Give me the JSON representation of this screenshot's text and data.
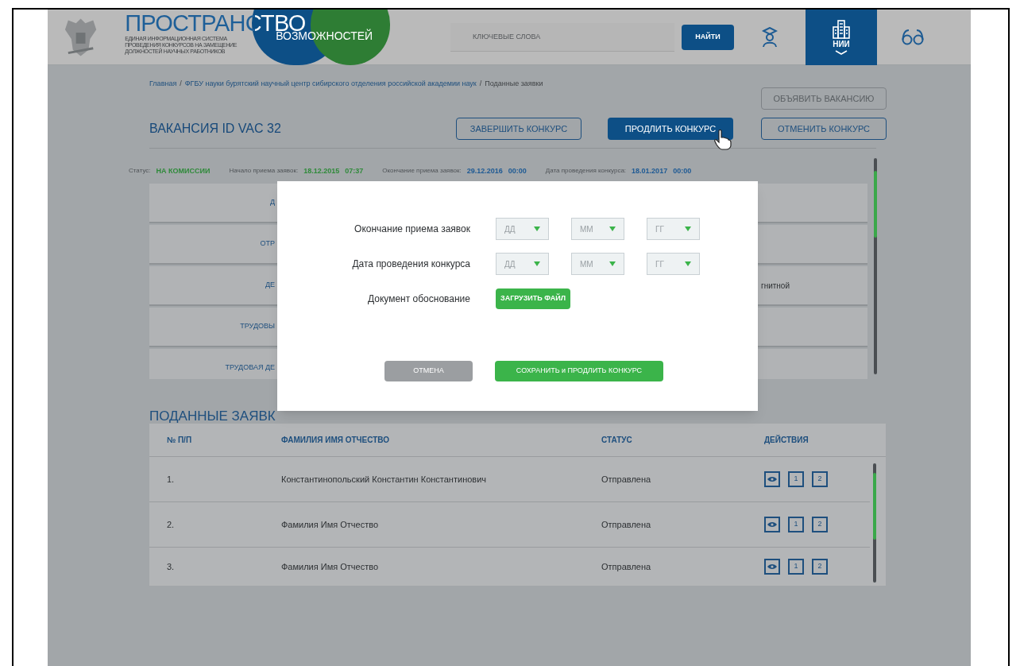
{
  "header": {
    "logo": {
      "title": "ПРОСТРАНСТВО",
      "subtitle": "ВОЗМОЖНОСТЕЙ",
      "tagline": [
        "ЕДИНАЯ ИНФОРМАЦИОННАЯ СИСТЕМА",
        "ПРОВЕДЕНИЯ КОНКУРСОВ НА ЗАМЕЩЕНИЕ",
        "ДОЛЖНОСТЕЙ НАУЧНЫХ РАБОТНИКОВ"
      ]
    },
    "search": {
      "placeholder": "КЛЮЧЕВЫЕ СЛОВА",
      "button": "НАЙТИ"
    },
    "nav": [
      {
        "kind": "person",
        "selected": false
      },
      {
        "kind": "institute",
        "label": "НИИ",
        "selected": true
      },
      {
        "kind": "glasses",
        "selected": false
      }
    ]
  },
  "breadcrumb_separator": "/",
  "breadcrumbs": [
    {
      "label": "Главная",
      "current": false
    },
    {
      "label": "ФГБУ науки бурятский научный центр сибирского отделения российской академии наук",
      "current": false
    },
    {
      "label": "Поданные заявки",
      "current": true
    }
  ],
  "announce_button": "ОБЪЯВИТЬ ВАКАНСИЮ",
  "vacancy": {
    "title": "ВАКАНСИЯ ID VAC 32",
    "actions": [
      {
        "label": "ЗАВЕРШИТЬ КОНКУРС",
        "primary": false
      },
      {
        "label": "ПРОДЛИТЬ КОНКУРС",
        "primary": true
      },
      {
        "label": "ОТМЕНИТЬ КОНКУРС",
        "primary": false
      }
    ]
  },
  "status_line": [
    {
      "label": "Статус:",
      "values": [
        "НА КОМИССИИ"
      ],
      "color": "#2f8a3a"
    },
    {
      "label": "Начало приема заявок:",
      "values": [
        "18.12.2015",
        "07:37"
      ],
      "color": "#2f8a3a"
    },
    {
      "label": "Окончание приема заявок:",
      "values": [
        "29.12.2016",
        "00:00"
      ],
      "color": "#1e5a94"
    },
    {
      "label": "Дата проведения конкурса:",
      "values": [
        "18.01.2017",
        "00:00"
      ],
      "color": "#1e5a94"
    }
  ],
  "detail_rows": [
    {
      "label": "Д"
    },
    {
      "label": "ОТР"
    },
    {
      "label": "ДЕ",
      "value": "гнитной"
    },
    {
      "label": "ТРУДОВЫ"
    },
    {
      "label": "ТРУДОВАЯ ДЕ"
    }
  ],
  "dialog": {
    "fields": [
      {
        "kind": "date",
        "label": "Окончание приема заявок",
        "selects": [
          "ДД",
          "ММ",
          "ГГ"
        ]
      },
      {
        "kind": "date",
        "label": "Дата проведения конкурса",
        "selects": [
          "ДД",
          "ММ",
          "ГГ"
        ]
      },
      {
        "kind": "file",
        "label": "Документ обоснование",
        "button": "ЗАГРУЗИТЬ ФАЙЛ"
      }
    ],
    "cancel": "ОТМЕНА",
    "submit": "СОХРАНИТЬ и ПРОДЛИТЬ КОНКУРС"
  },
  "applications": {
    "title": "ПОДАННЫЕ ЗАЯВК",
    "columns": [
      "№ П/П",
      "ФАМИЛИЯ ИМЯ ОТЧЕСТВО",
      "СТАТУС",
      "ДЕЙСТВИЯ"
    ],
    "rows": [
      {
        "number": "1.",
        "name": "Константинопольский Константин Константинович",
        "status": "Отправлена",
        "actions": [
          "1",
          "2"
        ]
      },
      {
        "number": "2.",
        "name": "Фамилия Имя Отчество",
        "status": "Отправлена",
        "actions": [
          "1",
          "2"
        ]
      },
      {
        "number": "3.",
        "name": "Фамилия Имя Отчество",
        "status": "Отправлена",
        "actions": [
          "1",
          "2"
        ]
      }
    ]
  }
}
